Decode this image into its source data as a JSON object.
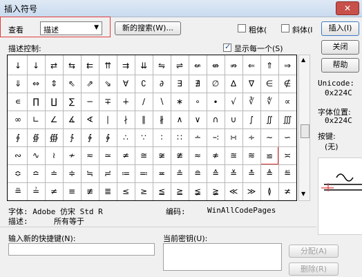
{
  "window": {
    "title": "插入符号",
    "close_label": "✕"
  },
  "header": {
    "view_label": "查看",
    "view_value": "描述",
    "new_search_label": "新的搜索(W)...",
    "bold_label": "粗体(",
    "italic_label": "斜体(I",
    "insert_label": "插入(I)"
  },
  "controls": {
    "describe_label": "描述控制:",
    "show_each_label": "显示每一个(S)",
    "close_label": "关闭",
    "help_label": "帮助"
  },
  "info": {
    "unicode_label": "Unicode:",
    "unicode_value": "0x224C",
    "font_pos_label": "字体位置:",
    "font_pos_value": "0x224C",
    "shortcut_label": "按键:",
    "shortcut_value": "(无)"
  },
  "symbols": [
    [
      "↓",
      "↓",
      "⇄",
      "⇆",
      "⇇",
      "⇈",
      "⇉",
      "⇊",
      "⇋",
      "⇌",
      "⇍",
      "⇎",
      "⇏",
      "⇐",
      "⇑",
      "⇒"
    ],
    [
      "⇓",
      "⇔",
      "⇕",
      "⇖",
      "⇗",
      "⇘",
      "∀",
      "∁",
      "∂",
      "∃",
      "∄",
      "∅",
      "∆",
      "∇",
      "∈",
      "∉"
    ],
    [
      "∊",
      "∏",
      "∐",
      "∑",
      "−",
      "∓",
      "∔",
      "∕",
      "∖",
      "∗",
      "∘",
      "∙",
      "√",
      "∛",
      "∜",
      "∝"
    ],
    [
      "∞",
      "∟",
      "∠",
      "∡",
      "∢",
      "∣",
      "∤",
      "∥",
      "∦",
      "∧",
      "∨",
      "∩",
      "∪",
      "∫",
      "∬",
      "∭"
    ],
    [
      "∮",
      "∯",
      "∰",
      "∱",
      "∲",
      "∳",
      "∴",
      "∵",
      "∶",
      "∷",
      "∸",
      "∹",
      "∺",
      "∻",
      "∼",
      "∽"
    ],
    [
      "∾",
      "∿",
      "≀",
      "≁",
      "≂",
      "≃",
      "≄",
      "≅",
      "≆",
      "≇",
      "≈",
      "≉",
      "≊",
      "≋",
      "≌",
      "≍"
    ],
    [
      "≎",
      "≏",
      "≐",
      "≑",
      "≒",
      "≓",
      "≔",
      "≕",
      "≖",
      "≗",
      "≘",
      "≙",
      "≚",
      "≛",
      "≜",
      "≝"
    ],
    [
      "≞",
      "≟",
      "≠",
      "≡",
      "≢",
      "≣",
      "≤",
      "≥",
      "≦",
      "≧",
      "≨",
      "≩",
      "≪",
      "≫",
      "≬",
      "≭"
    ]
  ],
  "footer": {
    "font_label": "字体: Adobe 仿宋 Std R",
    "encoding_label": "编码:",
    "encoding_value": "WinAllCodePages",
    "desc_label": "描述:",
    "desc_value": "所有等于",
    "new_shortcut_label": "输入新的快捷键(N):",
    "current_key_label": "当前密钥(U):",
    "assign_label": "分配(A)",
    "remove_label": "删除(R)"
  },
  "preview": {
    "glyph": "≌"
  }
}
